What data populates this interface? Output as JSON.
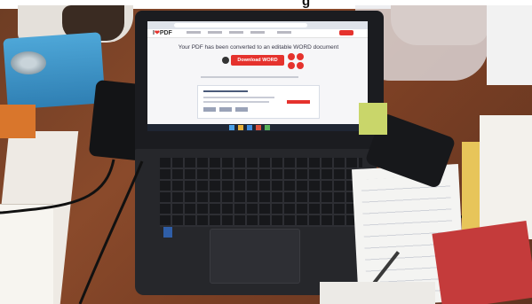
{
  "caption": {
    "partial_text": "g"
  },
  "laptop_screen": {
    "logo": {
      "prefix": "I",
      "heart": "❤",
      "suffix": "PDF"
    },
    "headline": "Your PDF has been converted to an editable WORD document",
    "download_button": "Download WORD"
  }
}
